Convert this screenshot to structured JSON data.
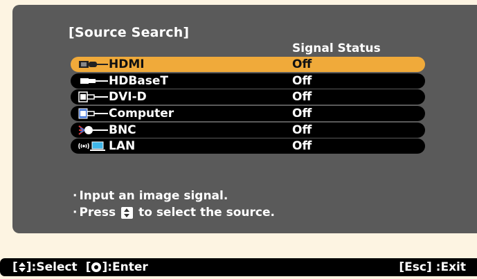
{
  "dialog": {
    "title": "[Source Search]",
    "column_header": "Signal Status"
  },
  "sources": [
    {
      "label": "HDMI",
      "status": "Off",
      "icon": "hdmi-connector-icon",
      "selected": true
    },
    {
      "label": "HDBaseT",
      "status": "Off",
      "icon": "hdbaset-connector-icon",
      "selected": false
    },
    {
      "label": "DVI-D",
      "status": "Off",
      "icon": "dvi-connector-icon",
      "selected": false
    },
    {
      "label": "Computer",
      "status": "Off",
      "icon": "vga-connector-icon",
      "selected": false
    },
    {
      "label": "BNC",
      "status": "Off",
      "icon": "bnc-connector-icon",
      "selected": false
    },
    {
      "label": "LAN",
      "status": "Off",
      "icon": "lan-network-icon",
      "selected": false
    }
  ],
  "info": {
    "line1": "Input an image signal.",
    "line2_before": "Press",
    "line2_after": "to select the source."
  },
  "footer": {
    "select_prefix": "[",
    "select_suffix": "]:Select",
    "enter_prefix": "[",
    "enter_suffix": "]:Enter",
    "exit": "[Esc] :Exit"
  },
  "colors": {
    "panel": "#5a5a5a",
    "selected_row": "#f0aa3a",
    "row": "#000000",
    "page_background": "#fdf4e2"
  }
}
